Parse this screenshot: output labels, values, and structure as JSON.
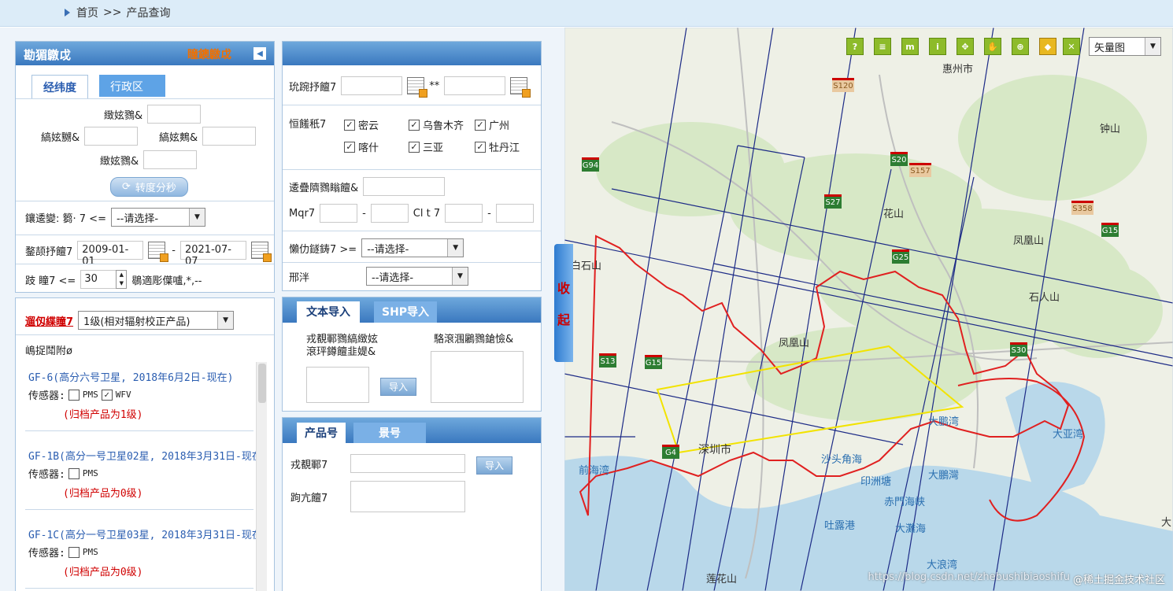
{
  "breadcrumb": {
    "home": "首页",
    "sep": ">>",
    "current": "产品查询"
  },
  "region_panel": {
    "title": "勘猸鷻戉",
    "title_link": "瞳鐭鷻戉",
    "tabs": [
      "经纬度",
      "行政区"
    ],
    "north_label": "緻妶鷚&",
    "west_label": "縞妶嬲&",
    "east_label": "縞妶鷞&",
    "south_label": "緻妶鷚&",
    "convert_btn": "转度分秒"
  },
  "filters": {
    "cloud_label": "鑲逶變:  篘·  7  <=",
    "cloud_select": "--请选择-",
    "time_label": "鍪颉抒饘7",
    "start_date": "2009-01-01",
    "end_date": "2021-07-07",
    "angle_label": "跂     瞳7    <=",
    "angle_value": "30",
    "angle_note": "鶡適彫僷嚧,*,--"
  },
  "product_level": {
    "label": "遛仭緤瞳7",
    "select": "1级(相对辐射校正产品)",
    "sat_header": "嶋捉鬦附ø"
  },
  "satellites": [
    {
      "name": "GF-6(高分六号卫星, 2018年6月2日-现在)",
      "sensor_label": "传感器:",
      "sensors": [
        {
          "name": "PMS",
          "checked": false
        },
        {
          "name": "WFV",
          "checked": true
        }
      ],
      "note": "(归档产品为1级)"
    },
    {
      "name": "GF-1B(高分一号卫星02星, 2018年3月31日-现在",
      "sensor_label": "传感器:",
      "sensors": [
        {
          "name": "PMS",
          "checked": false
        }
      ],
      "note": "(归档产品为0级)"
    },
    {
      "name": "GF-1C(高分一号卫星03星, 2018年3月31日-现在",
      "sensor_label": "传感器:",
      "sensors": [
        {
          "name": "PMS",
          "checked": false
        }
      ],
      "note": "(归档产品为0级)"
    }
  ],
  "mid_panel": {
    "date_label": "玧踠抒饘7",
    "star_sep": "**",
    "station_label": "恒饈秖7",
    "stations": [
      {
        "name": "密云",
        "checked": true
      },
      {
        "name": "乌鲁木齐",
        "checked": true
      },
      {
        "name": "广州",
        "checked": true
      },
      {
        "name": "喀什",
        "checked": true
      },
      {
        "name": "三亚",
        "checked": true
      },
      {
        "name": "牡丹江",
        "checked": true
      }
    ],
    "orbit_label": "逶疊隮鷚瞈饘&",
    "mqr_label": "Mqr7",
    "clt_label": "Cl t 7",
    "dash": "-",
    "product_type_label": "懶仂鐩鋳7  >=",
    "product_type_select": "--请选择-",
    "proc_label": "邢泮",
    "proc_select": "--请选择-"
  },
  "import_panel": {
    "tabs": [
      "文本导入",
      "SHP导入"
    ],
    "desc": "戎覩鄆鷚縞緻妶",
    "desc2": "滾玶鐏饘韭媞&",
    "right_label": "駱滾涠鷵鷚鎗憸&",
    "import_btn": "导入"
  },
  "product_panel": {
    "tabs": [
      "产品号",
      "景号"
    ],
    "field1_label": "戎覩鄆7",
    "field2_label": "跔亢饘7",
    "import_btn": "导入"
  },
  "collapse": {
    "c1": "收",
    "c2": "起"
  },
  "map": {
    "layer_select": "矢量图",
    "labels": [
      "惠州市",
      "钟山",
      "花山",
      "凤凰山",
      "白石山",
      "石人山",
      "凤凰山",
      "深圳市",
      "大鹏湾",
      "大亚湾",
      "沙头角海",
      "印洲塘",
      "赤門海峡",
      "大鵬灣",
      "吐露港",
      "大灘海",
      "大浪湾",
      "前海湾",
      "莲花山",
      "大"
    ],
    "shields": [
      "G94",
      "S20",
      "S27",
      "G25",
      "S358",
      "G15",
      "S30",
      "S13",
      "G15",
      "G4",
      "S120",
      "S157"
    ],
    "watermark": "@稀土掘金技术社区",
    "watermark_url": "https://blog.csdn.net/zhebushibiaoshifu",
    "tools": [
      "help-icon",
      "book-icon",
      "measure-icon",
      "info-icon",
      "fullextent-icon",
      "pan-icon",
      "zoom-icon",
      "eraser-icon",
      "clear-icon"
    ]
  }
}
